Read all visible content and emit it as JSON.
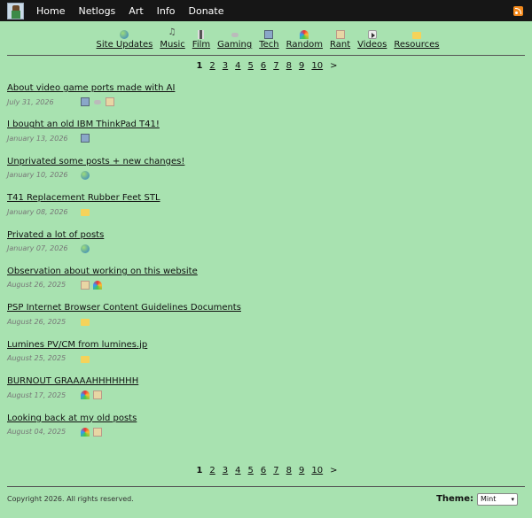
{
  "nav": {
    "links": [
      "Home",
      "Netlogs",
      "Art",
      "Info",
      "Donate"
    ]
  },
  "categories": [
    {
      "label": "Site Updates",
      "icon": "globe-icon"
    },
    {
      "label": "Music",
      "icon": "music-note-icon"
    },
    {
      "label": "Film",
      "icon": "film-icon"
    },
    {
      "label": "Gaming",
      "icon": "controller-icon"
    },
    {
      "label": "Tech",
      "icon": "computer-icon"
    },
    {
      "label": "Random",
      "icon": "rainbow-icon"
    },
    {
      "label": "Rant",
      "icon": "notepad-icon"
    },
    {
      "label": "Videos",
      "icon": "video-icon"
    },
    {
      "label": "Resources",
      "icon": "folder-icon"
    }
  ],
  "pagination": {
    "pages": [
      "1",
      "2",
      "3",
      "4",
      "5",
      "6",
      "7",
      "8",
      "9",
      "10"
    ],
    "current": "1",
    "next": ">"
  },
  "posts": [
    {
      "title": "About video game ports made with AI",
      "date": "July 31, 2026",
      "tags": [
        "computer-icon",
        "controller-icon",
        "notepad-icon"
      ]
    },
    {
      "title": "I bought an old IBM ThinkPad T41!",
      "date": "January 13, 2026",
      "tags": [
        "computer-icon"
      ]
    },
    {
      "title": "Unprivated some posts + new changes!",
      "date": "January 10, 2026",
      "tags": [
        "globe-icon"
      ]
    },
    {
      "title": "T41 Replacement Rubber Feet STL",
      "date": "January 08, 2026",
      "tags": [
        "folder-icon"
      ]
    },
    {
      "title": "Privated a lot of posts",
      "date": "January 07, 2026",
      "tags": [
        "globe-icon"
      ]
    },
    {
      "title": "Observation about working on this website",
      "date": "August 26, 2025",
      "tags": [
        "notepad-icon",
        "rainbow-icon"
      ]
    },
    {
      "title": "PSP Internet Browser Content Guidelines Documents",
      "date": "August 26, 2025",
      "tags": [
        "folder-icon"
      ]
    },
    {
      "title": "Lumines PV/CM from lumines.jp",
      "date": "August 25, 2025",
      "tags": [
        "folder-icon"
      ]
    },
    {
      "title": "BURNOUT GRAAAAHHHHHHH",
      "date": "August 17, 2025",
      "tags": [
        "rainbow-icon",
        "notepad-icon"
      ]
    },
    {
      "title": "Looking back at my old posts",
      "date": "August 04, 2025",
      "tags": [
        "rainbow-icon",
        "notepad-icon"
      ]
    }
  ],
  "footer": {
    "copyright": "Copyright 2026. All rights reserved.",
    "theme_label": "Theme:",
    "theme_value": "Mint"
  },
  "colors": {
    "background": "#a8e2b0",
    "topbar": "#161616",
    "rss": "#f48a1c"
  }
}
